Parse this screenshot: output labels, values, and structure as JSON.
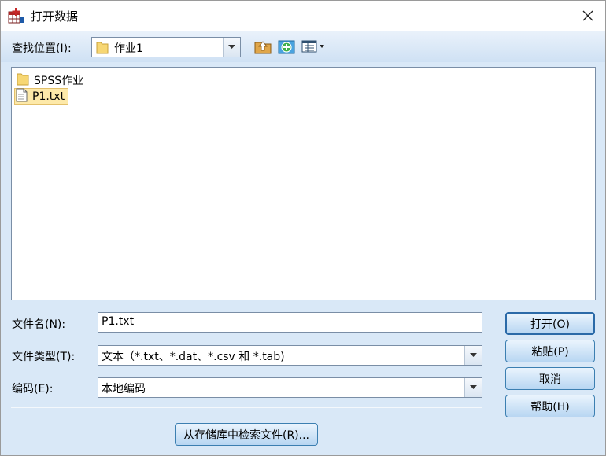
{
  "window": {
    "title": "打开数据"
  },
  "lookin": {
    "label": "查找位置(I):",
    "value": "作业1"
  },
  "toolbar": {
    "up_icon": "up-folder-icon",
    "new_folder_icon": "new-folder-icon",
    "view_icon": "view-menu-icon"
  },
  "files": [
    {
      "name": "SPSS作业",
      "type": "folder-icon",
      "selected": false
    },
    {
      "name": "P1.txt",
      "type": "text-file-icon",
      "selected": true
    }
  ],
  "filename": {
    "label": "文件名(N):",
    "value": "P1.txt"
  },
  "filetype": {
    "label": "文件类型(T):",
    "value": "文本（*.txt、*.dat、*.csv 和 *.tab)"
  },
  "encoding": {
    "label": "编码(E):",
    "value": "本地编码"
  },
  "buttons": {
    "open": "打开(O)",
    "paste": "粘贴(P)",
    "cancel": "取消",
    "help": "帮助(H)",
    "retrieve": "从存储库中检索文件(R)..."
  },
  "colors": {
    "accent": "#3c7fb1",
    "client_bg": "#d9e8f7",
    "selection": "#fde9a9"
  }
}
